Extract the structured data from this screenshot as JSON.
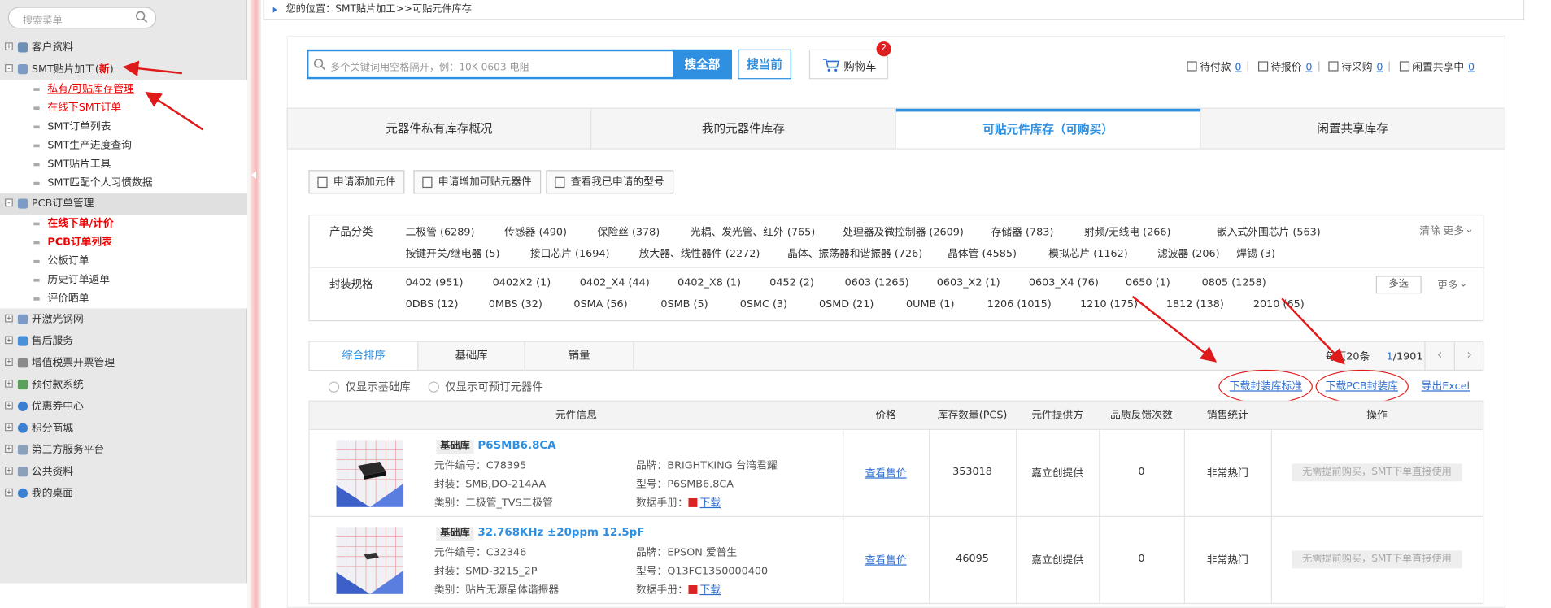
{
  "sidebar": {
    "search_placeholder": "搜索菜单",
    "items": [
      {
        "label": "客户资料"
      },
      {
        "label": "SMT贴片加工(",
        "new": "新",
        "sub": [
          {
            "label": "私有/可贴库存管理"
          },
          {
            "label": "在线下SMT订单"
          },
          {
            "label": "SMT订单列表"
          },
          {
            "label": "SMT生产进度查询"
          },
          {
            "label": "SMT贴片工具"
          },
          {
            "label": "SMT匹配个人习惯数据"
          }
        ]
      },
      {
        "label": "PCB订单管理",
        "sub": [
          {
            "label": "在线下单/计价"
          },
          {
            "label": "PCB订单列表"
          },
          {
            "label": "公板订单"
          },
          {
            "label": "历史订单返单"
          },
          {
            "label": "评价晒单"
          }
        ]
      },
      {
        "label": "开激光钢网"
      },
      {
        "label": "售后服务"
      },
      {
        "label": "增值税票开票管理"
      },
      {
        "label": "预付款系统"
      },
      {
        "label": "优惠券中心"
      },
      {
        "label": "积分商城"
      },
      {
        "label": "第三方服务平台"
      },
      {
        "label": "公共资料"
      },
      {
        "label": "我的桌面"
      }
    ]
  },
  "breadcrumb": "您的位置：SMT贴片加工>>可贴元件库存",
  "search": {
    "placeholder": "多个关键词用空格隔开，例：10K 0603 电阻",
    "btn_all": "搜全部",
    "btn_current": "搜当前"
  },
  "cart": {
    "label": "购物车",
    "count": "2"
  },
  "stats": [
    {
      "label": "待付款",
      "value": "0"
    },
    {
      "label": "待报价",
      "value": "0"
    },
    {
      "label": "待采购",
      "value": "0"
    },
    {
      "label": "闲置共享中",
      "value": "0"
    }
  ],
  "tabs": [
    {
      "label": "元器件私有库存概况"
    },
    {
      "label": "我的元器件库存"
    },
    {
      "label": "可贴元件库存（可购买）"
    },
    {
      "label": "闲置共享库存"
    }
  ],
  "action_buttons": [
    {
      "label": "申请添加元件"
    },
    {
      "label": "申请增加可贴元器件"
    },
    {
      "label": "查看我已申请的型号"
    }
  ],
  "filter": {
    "category_title": "产品分类",
    "categories": [
      "二极管 (6289)",
      "传感器 (490)",
      "保险丝 (378)",
      "光耦、发光管、红外 (765)",
      "处理器及微控制器 (2609)",
      "存储器 (783)",
      "射频/无线电 (266)",
      "嵌入式外围芯片 (563)",
      "按键开关/继电器 (5)",
      "接口芯片 (1694)",
      "放大器、线性器件 (2272)",
      "晶体、振荡器和谐振器 (726)",
      "晶体管 (4585)",
      "模拟芯片 (1162)",
      "滤波器 (206)",
      "焊锡 (3)"
    ],
    "clear": "清除",
    "more": "更多",
    "package_title": "封装规格",
    "packages": [
      "0402 (951)",
      "0402X2 (1)",
      "0402_X4 (44)",
      "0402_X8 (1)",
      "0452 (2)",
      "0603 (1265)",
      "0603_X2 (1)",
      "0603_X4 (76)",
      "0650 (1)",
      "0805 (1258)",
      "0DBS (12)",
      "0MBS (32)",
      "0SMA (56)",
      "0SMB (5)",
      "0SMC (3)",
      "0SMD (21)",
      "0UMB (1)",
      "1206 (1015)",
      "1210 (175)",
      "1812 (138)",
      "2010 (65)"
    ],
    "multi": "多选"
  },
  "sort": {
    "options": [
      {
        "label": "综合排序"
      },
      {
        "label": "基础库"
      },
      {
        "label": "销量"
      }
    ],
    "per_page": "每页20条",
    "page": "1",
    "pages": "/1901",
    "prev": "‹",
    "next": "›"
  },
  "options": [
    {
      "label": "仅显示基础库"
    },
    {
      "label": "仅显示可预订元器件"
    }
  ],
  "links": {
    "download_std": "下载封装库标准",
    "download_pcb": "下载PCB封装库",
    "export": "导出Excel"
  },
  "columns": [
    "元件信息",
    "价格",
    "库存数量(PCS)",
    "元件提供方",
    "品质反馈次数",
    "销售统计",
    "操作"
  ],
  "products": [
    {
      "lib": "基础库",
      "name": "P6SMB6.8CA",
      "code": "元件编号：C78395",
      "package": "封装：SMB,DO-214AA",
      "category": "类别：二极管_TVS二极管",
      "brand": "品牌：BRIGHTKING 台湾君耀",
      "model": "型号：P6SMB6.8CA",
      "datasheet": "数据手册：",
      "download": "下载",
      "price": "查看售价",
      "stock": "353018",
      "provider": "嘉立创提供",
      "feedback": "0",
      "sales": "非常热门",
      "action": "无需提前购买，SMT下单直接使用"
    },
    {
      "lib": "基础库",
      "name": "32.768KHz ±20ppm 12.5pF",
      "code": "元件编号：C32346",
      "package": "封装：SMD-3215_2P",
      "category": "类别：贴片无源晶体谐振器",
      "brand": "品牌：EPSON 爱普生",
      "model": "型号：Q13FC1350000400",
      "datasheet": "数据手册：",
      "download": "下载",
      "price": "查看售价",
      "stock": "46095",
      "provider": "嘉立创提供",
      "feedback": "0",
      "sales": "非常热门",
      "action": "无需提前购买，SMT下单直接使用"
    }
  ],
  "colors": {
    "accent": "#2f8fe0",
    "alert": "#e01a1a"
  },
  "icons": [
    "search-icon",
    "cart-icon",
    "plus-box-icon",
    "menu-icon",
    "pdf-icon",
    "red-arrow"
  ]
}
